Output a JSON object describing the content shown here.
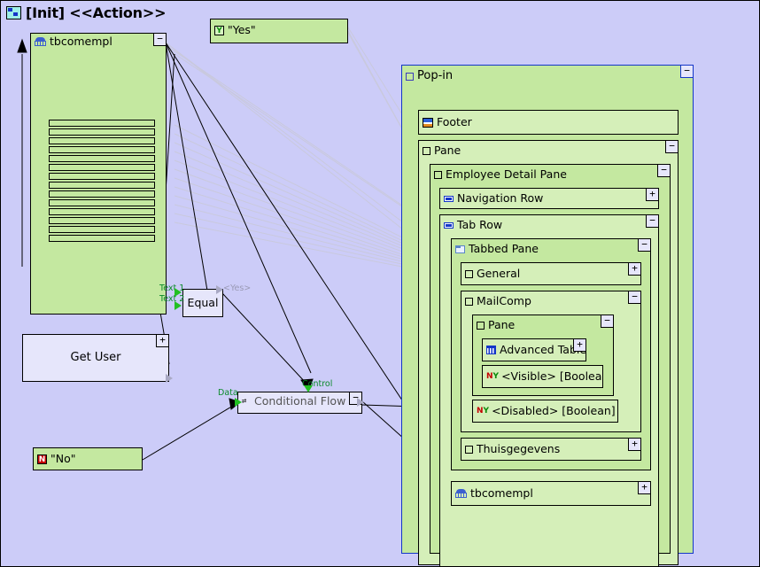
{
  "window": {
    "title": "[Init] <<Action>>",
    "icon": "diagram-icon",
    "background_color": "#ccccf8"
  },
  "colors": {
    "canvas_background": "#ccccf8",
    "node_green": "#c4e8a0",
    "node_green_light": "#d5efb9",
    "node_lavender": "#e6e6fb",
    "port_green": "#22c022",
    "port_grey": "#a9a9c4",
    "label_green": "#0b8a2a",
    "label_grey": "#9a9ab5",
    "border": "#000000",
    "selection_blue": "#1436c8"
  },
  "left_flow": {
    "table_node": {
      "label": "tbcomempl",
      "icon": "table-icon",
      "toggle": "−",
      "collapsed_rows": 14
    },
    "yes_literal": {
      "label": "\"Yes\"",
      "icon": "yes-literal-icon",
      "icon_glyph": "Y"
    },
    "no_literal": {
      "label": "\"No\"",
      "icon": "no-literal-icon",
      "icon_glyph": "N"
    },
    "get_user": {
      "label": "Get User",
      "toggle": "+"
    },
    "equal_node": {
      "label": "Equal",
      "inputs": [
        "Text 1",
        "Text 2"
      ],
      "output": "<Yes>"
    },
    "conditional_flow": {
      "label": "Conditional Flow",
      "icon": "branch-icon",
      "toggle": "−",
      "input_data": "Data",
      "input_control": "Control"
    }
  },
  "popin": {
    "label": "Pop-in",
    "icon": "panel-icon",
    "toggle": "−",
    "children": [
      {
        "label": "Footer",
        "icon": "footer-icon",
        "toggle": ""
      },
      {
        "label": "Pane",
        "icon": "panel-icon",
        "toggle": "−"
      },
      {
        "label": "Employee Detail Pane",
        "icon": "panel-icon",
        "toggle": "−"
      },
      {
        "label": "Navigation Row",
        "icon": "row-icon",
        "toggle": "+"
      },
      {
        "label": "Tab Row",
        "icon": "row-icon",
        "toggle": "−"
      },
      {
        "label": "Tabbed Pane",
        "icon": "tabbed-pane-icon",
        "toggle": "−"
      },
      {
        "label": "General",
        "icon": "panel-icon",
        "toggle": "+"
      },
      {
        "label": "MailComp",
        "icon": "panel-icon",
        "toggle": "−"
      },
      {
        "label": "Pane",
        "icon": "panel-icon",
        "toggle": "−"
      },
      {
        "label": "Advanced Table",
        "icon": "grid-icon",
        "toggle": "+"
      },
      {
        "label": "<Visible> [Boolean]",
        "icon": "ny-property-icon",
        "toggle": ""
      },
      {
        "label": "<Disabled> [Boolean]",
        "icon": "ny-property-icon",
        "toggle": ""
      },
      {
        "label": "Thuisgegevens",
        "icon": "panel-icon",
        "toggle": "+"
      },
      {
        "label": "tbcomempl",
        "icon": "table-icon",
        "toggle": "+"
      }
    ]
  }
}
